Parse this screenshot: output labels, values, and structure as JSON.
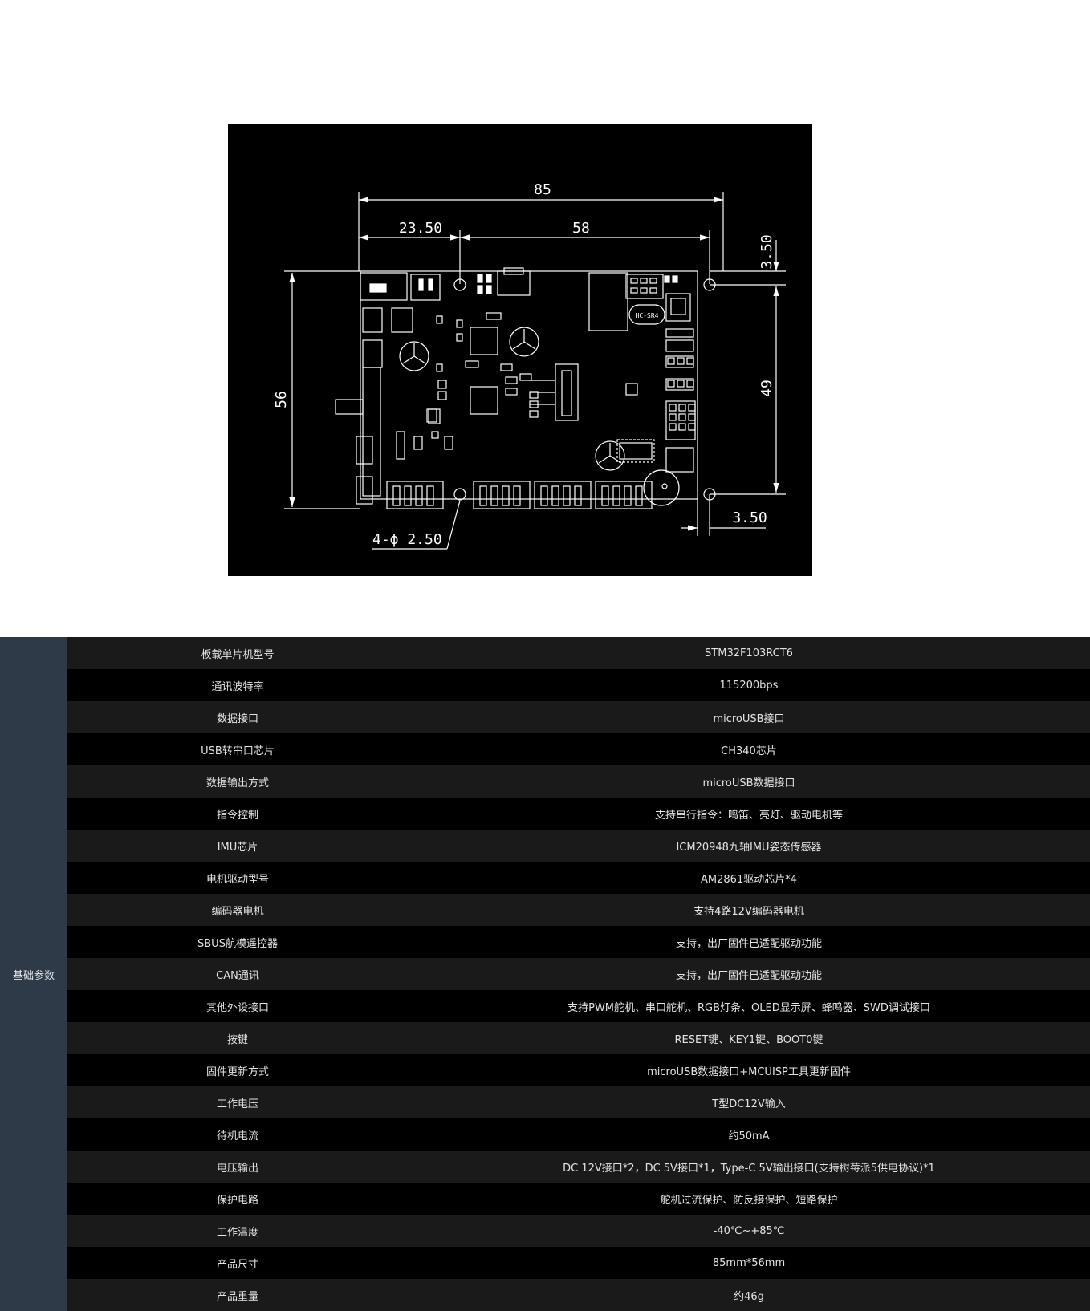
{
  "drawing": {
    "dims": {
      "total_width": "85",
      "left_offset": "23.50",
      "hole_span": "58",
      "top_offset": "3.50",
      "height": "56",
      "hole_height": "49",
      "bottom_offset": "3.50",
      "hole_dia": "4-ϕ 2.50"
    },
    "chip_label": "HC-SR4"
  },
  "specs": {
    "category": "基础参数",
    "rows": [
      {
        "k": "板载单片机型号",
        "v": "STM32F103RCT6"
      },
      {
        "k": "通讯波特率",
        "v": "115200bps"
      },
      {
        "k": "数据接口",
        "v": "microUSB接口"
      },
      {
        "k": "USB转串口芯片",
        "v": "CH340芯片"
      },
      {
        "k": "数据输出方式",
        "v": "microUSB数据接口"
      },
      {
        "k": "指令控制",
        "v": "支持串行指令：鸣笛、亮灯、驱动电机等"
      },
      {
        "k": "IMU芯片",
        "v": "ICM20948九轴IMU姿态传感器"
      },
      {
        "k": "电机驱动型号",
        "v": "AM2861驱动芯片*4"
      },
      {
        "k": "编码器电机",
        "v": "支持4路12V编码器电机"
      },
      {
        "k": "SBUS航模遥控器",
        "v": "支持，出厂固件已适配驱动功能"
      },
      {
        "k": "CAN通讯",
        "v": "支持，出厂固件已适配驱动功能"
      },
      {
        "k": "其他外设接口",
        "v": "支持PWM舵机、串口舵机、RGB灯条、OLED显示屏、蜂鸣器、SWD调试接口"
      },
      {
        "k": "按键",
        "v": "RESET键、KEY1键、BOOT0键"
      },
      {
        "k": "固件更新方式",
        "v": "microUSB数据接口+MCUISP工具更新固件"
      },
      {
        "k": "工作电压",
        "v": "T型DC12V输入"
      },
      {
        "k": "待机电流",
        "v": "约50mA"
      },
      {
        "k": "电压输出",
        "v": "DC 12V接口*2，DC 5V接口*1，Type-C 5V输出接口(支持树莓派5供电协议)*1"
      },
      {
        "k": "保护电路",
        "v": "舵机过流保护、防反接保护、短路保护"
      },
      {
        "k": "工作温度",
        "v": "-40℃~+85℃"
      },
      {
        "k": "产品尺寸",
        "v": "85mm*56mm"
      },
      {
        "k": "产品重量",
        "v": "约46g"
      }
    ]
  }
}
